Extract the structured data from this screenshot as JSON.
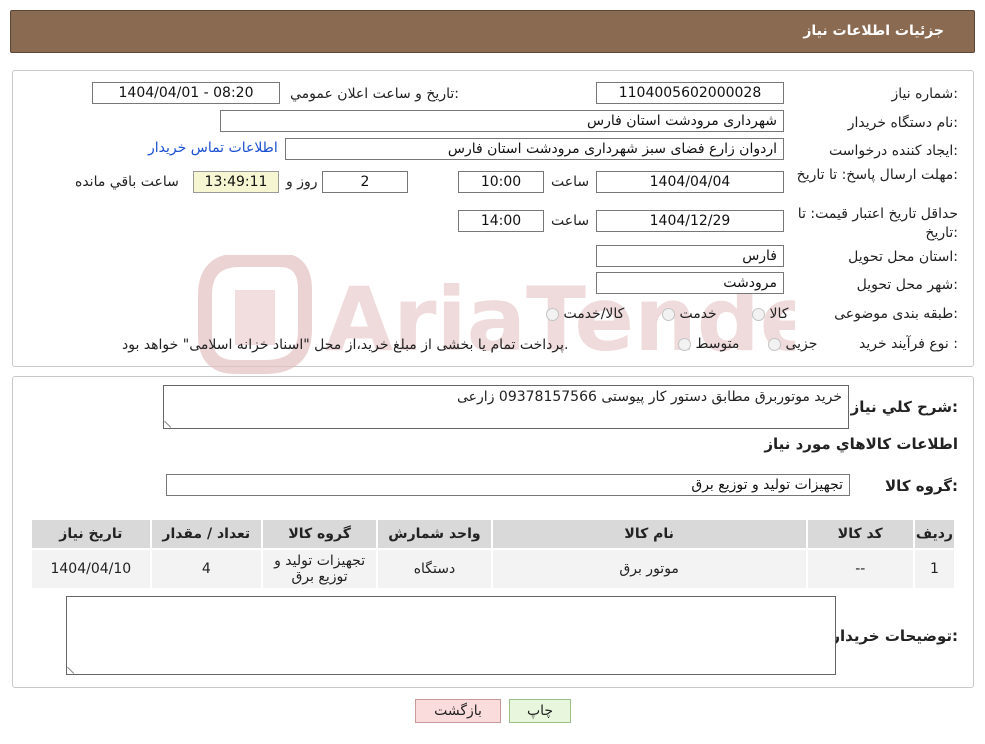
{
  "header": {
    "title": "جزئیات اطلاعات نیاز"
  },
  "form": {
    "need_number_label": "شماره نیاز:",
    "need_number_value": "1104005602000028",
    "announce_label": "تاریخ و ساعت اعلان عمومي:",
    "announce_value": "1404/04/01 - 08:20",
    "buyer_org_label": "نام دستگاه خریدار:",
    "buyer_org_value": "شهرداری مرودشت استان فارس",
    "creator_label": "ایجاد کننده درخواست:",
    "creator_value": "اردوان زارع فضای سبز شهرداری مرودشت استان فارس",
    "contact_link": "اطلاعات تماس خریدار",
    "deadline_label": "مهلت ارسال پاسخ: تا تاریخ:",
    "deadline_date": "1404/04/04",
    "time_label": "ساعت",
    "deadline_time": "10:00",
    "days_value": "2",
    "days_label": "روز و",
    "remaining_value": "13:49:11",
    "remaining_label": "ساعت باقي مانده",
    "validity_label": "حداقل تاریخ اعتبار قیمت: تا تاریخ:",
    "validity_date": "1404/12/29",
    "validity_time": "14:00",
    "province_label": "استان محل تحویل:",
    "province_value": "فارس",
    "city_label": "شهر محل تحویل:",
    "city_value": "مرودشت",
    "category_label": "طبقه بندی موضوعی:",
    "category_options": [
      "کالا",
      "خدمت",
      "کالا/خدمت"
    ],
    "purchase_type_label": "نوع فرآیند خرید :",
    "purchase_type_options": [
      "جزیی",
      "متوسط"
    ],
    "purchase_note": "پرداخت تمام یا بخشی از مبلغ خرید،از محل \"اسناد خزانه اسلامی\" خواهد بود."
  },
  "details": {
    "description_label": "شرح کلي نیاز:",
    "description_value": "خرید موتوربرق  مطابق دستور کار پیوستی 09378157566 زارعی",
    "goods_info_title": "اطلاعات کالاهاي مورد نیاز",
    "goods_group_label": "گروه کالا:",
    "goods_group_value": "تجهیزات تولید و توزیع برق",
    "buyer_notes_label": "توضیحات خریدار:",
    "buyer_notes_value": ""
  },
  "table": {
    "headers": [
      "ردیف",
      "کد کالا",
      "نام کالا",
      "واحد شمارش",
      "گروه کالا",
      "تعداد / مقدار",
      "تاریخ نیاز"
    ],
    "rows": [
      [
        "1",
        "--",
        "موتور برق",
        "دستگاه",
        "تجهیزات تولید و توزیع برق",
        "4",
        "1404/04/10"
      ]
    ]
  },
  "buttons": {
    "print": "چاپ",
    "back": "بازگشت"
  },
  "watermark": {
    "text": "AriaTender.neT"
  },
  "colors": {
    "header_bg": "#8a6a51",
    "link": "#1a4fd0",
    "back_button_bg": "#fbdcdc",
    "print_button_bg": "#e7f6dc",
    "remaining_bg": "#f6f6d2"
  }
}
